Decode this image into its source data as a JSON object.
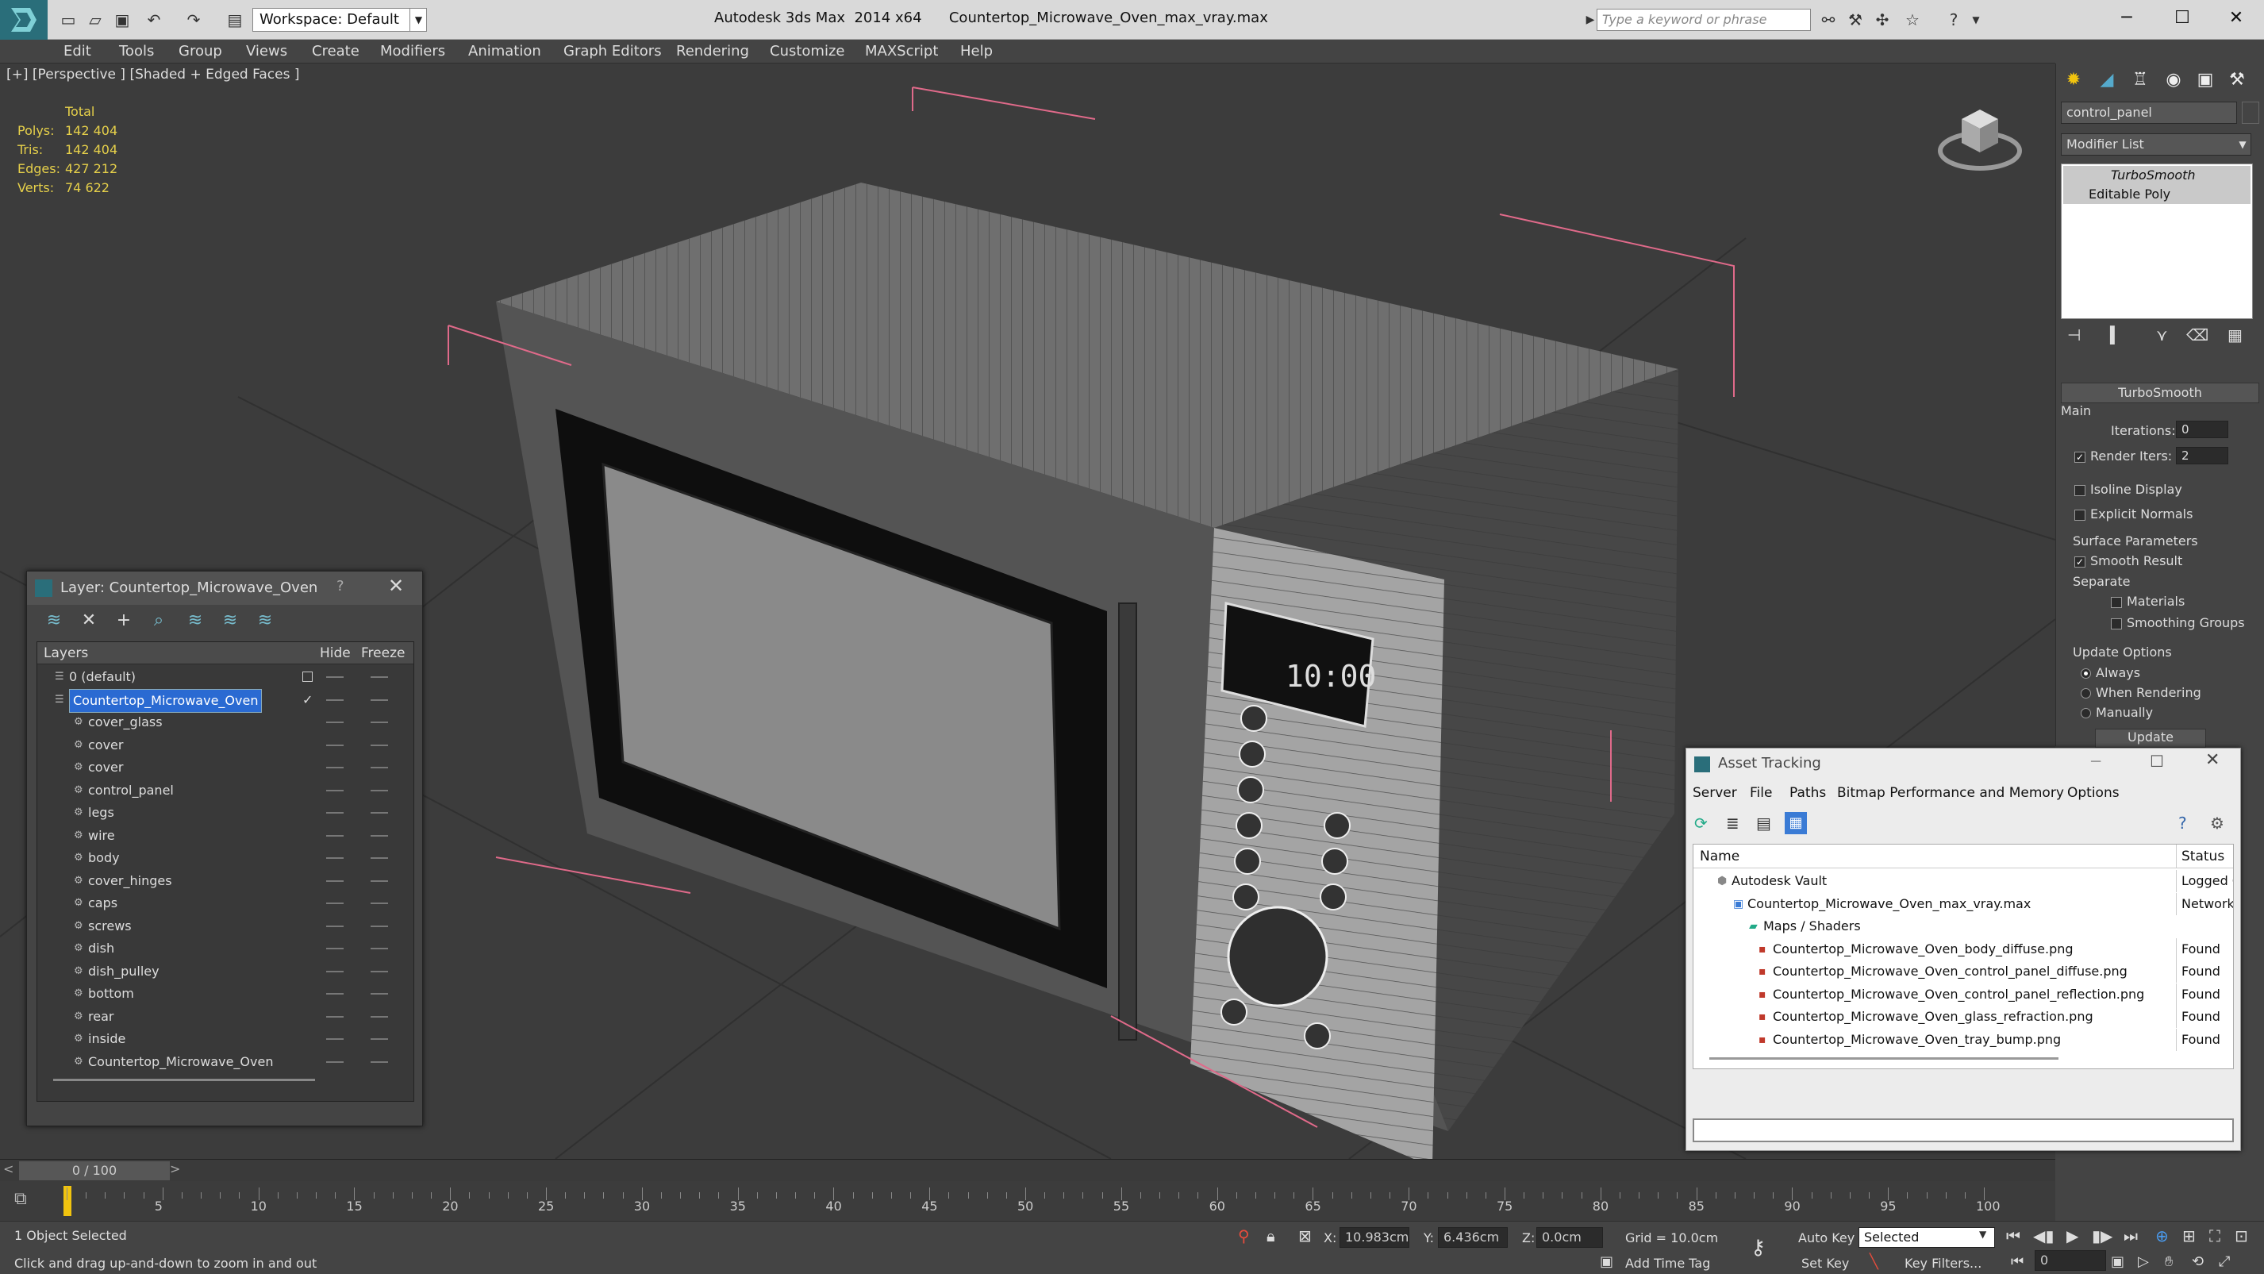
{
  "app": {
    "title": "Autodesk 3ds Max  2014 x64      Countertop_Microwave_Oven_max_vray.max",
    "workspace": "Workspace: Default",
    "search_placeholder": "Type a keyword or phrase"
  },
  "menu": [
    "Edit",
    "Tools",
    "Group",
    "Views",
    "Create",
    "Modifiers",
    "Animation",
    "Graph Editors",
    "Rendering",
    "Customize",
    "MAXScript",
    "Help"
  ],
  "viewport": {
    "label": "[+] [Perspective ] [Shaded + Edged Faces ]",
    "stats": {
      "header": "Total",
      "polys_label": "Polys:",
      "polys": "142 404",
      "tris_label": "Tris:",
      "tris": "142 404",
      "edges_label": "Edges:",
      "edges": "427 212",
      "verts_label": "Verts:",
      "verts": "74 622"
    },
    "display_time": "10:00"
  },
  "command_panel": {
    "object_name": "control_panel",
    "modifier_list": "Modifier List",
    "stack": [
      "TurboSmooth",
      "Editable Poly"
    ],
    "rollout_title": "TurboSmooth",
    "main_label": "Main",
    "iterations_label": "Iterations:",
    "iterations": "0",
    "render_iters_label": "Render Iters:",
    "render_iters": "2",
    "isoline": "Isoline Display",
    "explicit_normals": "Explicit Normals",
    "surface_params": "Surface Parameters",
    "smooth_result": "Smooth Result",
    "separate": "Separate",
    "materials": "Materials",
    "smoothing_groups": "Smoothing Groups",
    "update_options": "Update Options",
    "always": "Always",
    "when_rendering": "When Rendering",
    "manually": "Manually",
    "update_button": "Update"
  },
  "layer_panel": {
    "title": "Layer: Countertop_Microwave_Oven",
    "help": "?",
    "col_layers": "Layers",
    "col_hide": "Hide",
    "col_freeze": "Freeze",
    "rows": [
      "0 (default)",
      "Countertop_Microwave_Oven",
      "cover_glass",
      "cover",
      "cover",
      "control_panel",
      "legs",
      "wire",
      "body",
      "cover_hinges",
      "caps",
      "screws",
      "dish",
      "dish_pulley",
      "bottom",
      "rear",
      "inside",
      "Countertop_Microwave_Oven"
    ]
  },
  "asset_tracking": {
    "title": "Asset Tracking",
    "menu": [
      "Server",
      "File",
      "Paths",
      "Bitmap Performance and Memory",
      "Options"
    ],
    "col_name": "Name",
    "col_status": "Status",
    "rows": [
      {
        "name": "Autodesk Vault",
        "status": "Logged O"
      },
      {
        "name": "Countertop_Microwave_Oven_max_vray.max",
        "status": "Network"
      },
      {
        "name": "Maps / Shaders",
        "status": ""
      },
      {
        "name": "Countertop_Microwave_Oven_body_diffuse.png",
        "status": "Found"
      },
      {
        "name": "Countertop_Microwave_Oven_control_panel_diffuse.png",
        "status": "Found"
      },
      {
        "name": "Countertop_Microwave_Oven_control_panel_reflection.png",
        "status": "Found"
      },
      {
        "name": "Countertop_Microwave_Oven_glass_refraction.png",
        "status": "Found"
      },
      {
        "name": "Countertop_Microwave_Oven_tray_bump.png",
        "status": "Found"
      }
    ]
  },
  "timeline": {
    "frame": "0 / 100",
    "ticks": [
      "5",
      "10",
      "15",
      "20",
      "25",
      "30",
      "35",
      "40",
      "45",
      "50",
      "55",
      "60",
      "65",
      "70",
      "75",
      "80",
      "85",
      "90",
      "95",
      "100"
    ]
  },
  "status": {
    "selected": "1 Object Selected",
    "hint": "Click and drag up-and-down to zoom in and out",
    "x_label": "X:",
    "x": "10.983cm",
    "y_label": "Y:",
    "y": "6.436cm",
    "z_label": "Z:",
    "z": "0.0cm",
    "grid": "Grid = 10.0cm",
    "add_time_tag": "Add Time Tag",
    "auto_key": "Auto Key",
    "set_key": "Set Key",
    "key_mode": "Selected",
    "key_filters": "Key Filters...",
    "frame_field": "0"
  }
}
